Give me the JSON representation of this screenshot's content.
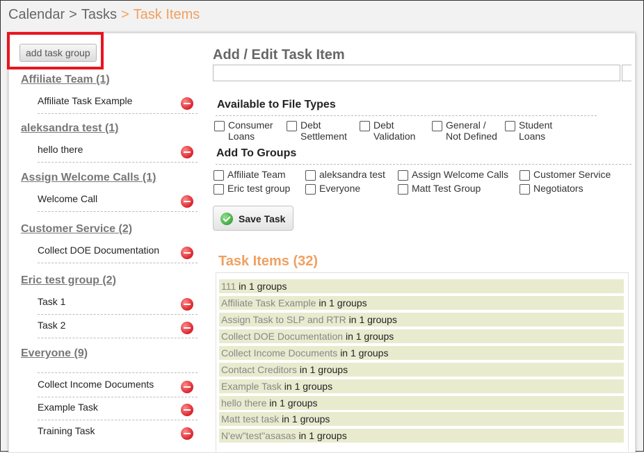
{
  "breadcrumb": {
    "items": [
      "Calendar",
      "Tasks",
      "Task Items"
    ],
    "separator": ">"
  },
  "sidebar": {
    "add_group_label": "add task group",
    "groups": [
      {
        "title": "Affiliate Team (1)",
        "items": [
          "Affiliate Task Example"
        ]
      },
      {
        "title": "aleksandra test (1)",
        "items": [
          "hello there"
        ]
      },
      {
        "title": "Assign Welcome Calls (1)",
        "items": [
          "Welcome Call"
        ]
      },
      {
        "title": "Customer Service (2)",
        "items": [
          "Collect DOE Documentation"
        ]
      },
      {
        "title": "Eric test group (2)",
        "items": [
          "Task 1",
          "Task 2"
        ]
      },
      {
        "title": "Everyone (9)",
        "items": [
          "Collect Income Documents",
          "Example Task",
          "Training Task"
        ]
      }
    ]
  },
  "editor": {
    "title": "Add / Edit Task Item",
    "name_value": "",
    "file_types_title": "Available to File Types",
    "file_types": [
      {
        "line1": "Consumer",
        "line2": "Loans",
        "checked": false
      },
      {
        "line1": "Debt",
        "line2": "Settlement",
        "checked": false
      },
      {
        "line1": "Debt",
        "line2": "Validation",
        "checked": false
      },
      {
        "line1": "General /",
        "line2": "Not Defined",
        "checked": false
      },
      {
        "line1": "Student",
        "line2": "Loans",
        "checked": false
      }
    ],
    "groups_title": "Add To Groups",
    "groups": [
      "Affiliate Team",
      "aleksandra test",
      "Assign Welcome Calls",
      "Customer Service",
      "Eric test group",
      "Everyone",
      "Matt Test Group",
      "Negotiators"
    ],
    "save_label": "Save Task"
  },
  "task_items": {
    "title": "Task Items (32)",
    "rows": [
      {
        "name": "111",
        "suffix": "in 1 groups"
      },
      {
        "name": "Affiliate Task Example",
        "suffix": "in 1 groups"
      },
      {
        "name": "Assign Task to SLP and RTR",
        "suffix": "in 1 groups"
      },
      {
        "name": "Collect DOE Documentation",
        "suffix": "in 1 groups"
      },
      {
        "name": "Collect Income Documents",
        "suffix": "in 1 groups"
      },
      {
        "name": "Contact Creditors",
        "suffix": "in 1 groups"
      },
      {
        "name": "Example Task",
        "suffix": "in 1 groups"
      },
      {
        "name": "hello there",
        "suffix": "in 1 groups"
      },
      {
        "name": "Matt test task",
        "suffix": "in 1 groups"
      },
      {
        "name": "N'ew\"test\"asasas",
        "suffix": "in 1 groups"
      }
    ]
  },
  "colors": {
    "accent": "#f0a060",
    "highlight": "#e8151e",
    "row_bg": "#e9ebcf"
  }
}
